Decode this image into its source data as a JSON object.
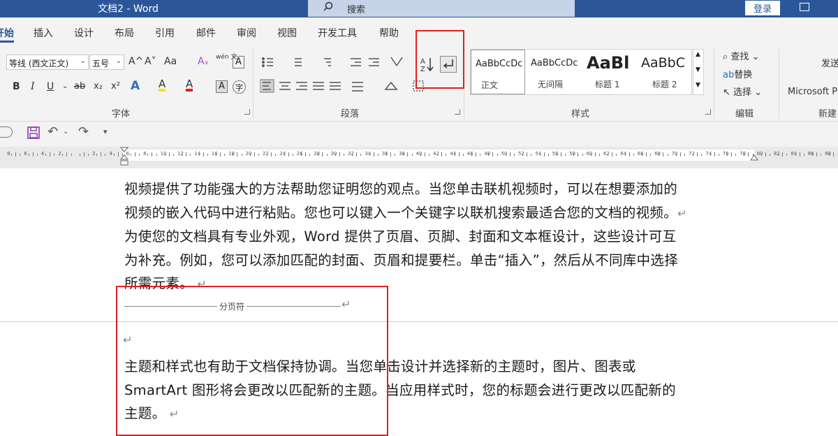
{
  "titlebar": {
    "title": "文档2 - Word",
    "search_placeholder": "搜索",
    "login": "登录"
  },
  "tabs": [
    "开始",
    "插入",
    "设计",
    "布局",
    "引用",
    "邮件",
    "审阅",
    "视图",
    "开发工具",
    "帮助"
  ],
  "font_group": {
    "font_name": "等线 (西文正文)",
    "font_size": "五号",
    "label": "字体",
    "row1_buttons": [
      "A^",
      "A˅",
      "Aa",
      "wén 文",
      "A"
    ],
    "row2_buttons": [
      "B",
      "I",
      "U",
      "ab",
      "x₂",
      "x²",
      "A",
      "A",
      "A",
      "A",
      "字"
    ]
  },
  "paragraph_group": {
    "label": "段落"
  },
  "styles_group": {
    "label": "样式",
    "styles": [
      {
        "preview": "AaBbCcDc",
        "name": "正文"
      },
      {
        "preview": "AaBbCcDc",
        "name": "无间隔"
      },
      {
        "preview": "AaBl",
        "name": "标题 1"
      },
      {
        "preview": "AaBbC",
        "name": "标题 2"
      }
    ]
  },
  "editing_group": {
    "label": "编辑",
    "find": "查找",
    "replace": "替换",
    "select": "选择"
  },
  "addins_group": {
    "label": "新建",
    "send": "发送",
    "microsoft": "Microsoft P"
  },
  "ruler": {
    "numbers": [
      "8",
      "6",
      "4",
      "2",
      "",
      "2",
      "4",
      "6",
      "8",
      "10",
      "12",
      "14",
      "16",
      "18",
      "20",
      "22",
      "24",
      "26",
      "28",
      "30",
      "32",
      "34",
      "36",
      "38",
      "40",
      "42",
      "44",
      "46",
      "48",
      "50",
      "52",
      "54",
      "56",
      "58",
      "60",
      "62",
      "64",
      "66",
      "68",
      "70",
      "72",
      "74",
      "76",
      "78",
      "80",
      "82",
      "84",
      "86",
      "88"
    ]
  },
  "document": {
    "lines": [
      "视频提供了功能强大的方法帮助您证明您的观点。当您单击联机视频时，可以在想要添加的",
      "视频的嵌入代码中进行粘贴。您也可以键入一个关键字以联机搜索最适合您的文档的视频。",
      "为使您的文档具有专业外观，Word 提供了页眉、页脚、封面和文本框设计，这些设计可互",
      "为补充。例如，您可以添加匹配的封面、页眉和提要栏。单击“插入”，然后从不同库中选择",
      "所需元素。",
      "主题和样式也有助于文档保持协调。当您单击设计并选择新的主题时，图片、图表或",
      "SmartArt 图形将会更改以匹配新的主题。当应用样式时，您的标题会进行更改以匹配新的",
      "主题。"
    ],
    "page_break": "分页符"
  }
}
